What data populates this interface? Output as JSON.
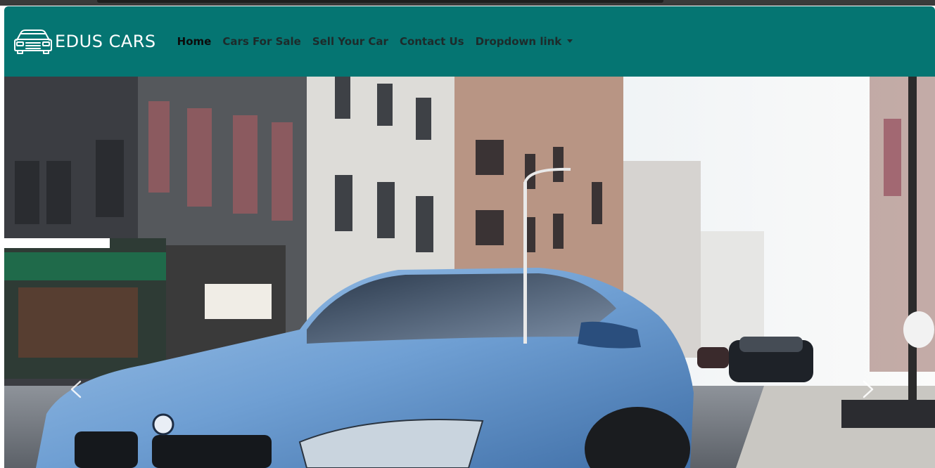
{
  "brand": {
    "name": "EDUS CARS",
    "logo_icon": "car-front-icon"
  },
  "nav": {
    "items": [
      {
        "label": "Home",
        "active": true
      },
      {
        "label": "Cars For Sale",
        "active": false
      },
      {
        "label": "Sell Your Car",
        "active": false
      },
      {
        "label": "Contact Us",
        "active": false
      },
      {
        "label": "Dropdown link",
        "active": false,
        "dropdown": true
      }
    ]
  },
  "carousel": {
    "prev_icon": "chevron-left-icon",
    "next_icon": "chevron-right-icon"
  },
  "colors": {
    "navbar": "#057572",
    "nav_text": "#1d2b2b",
    "brand_text": "#ffffff"
  }
}
